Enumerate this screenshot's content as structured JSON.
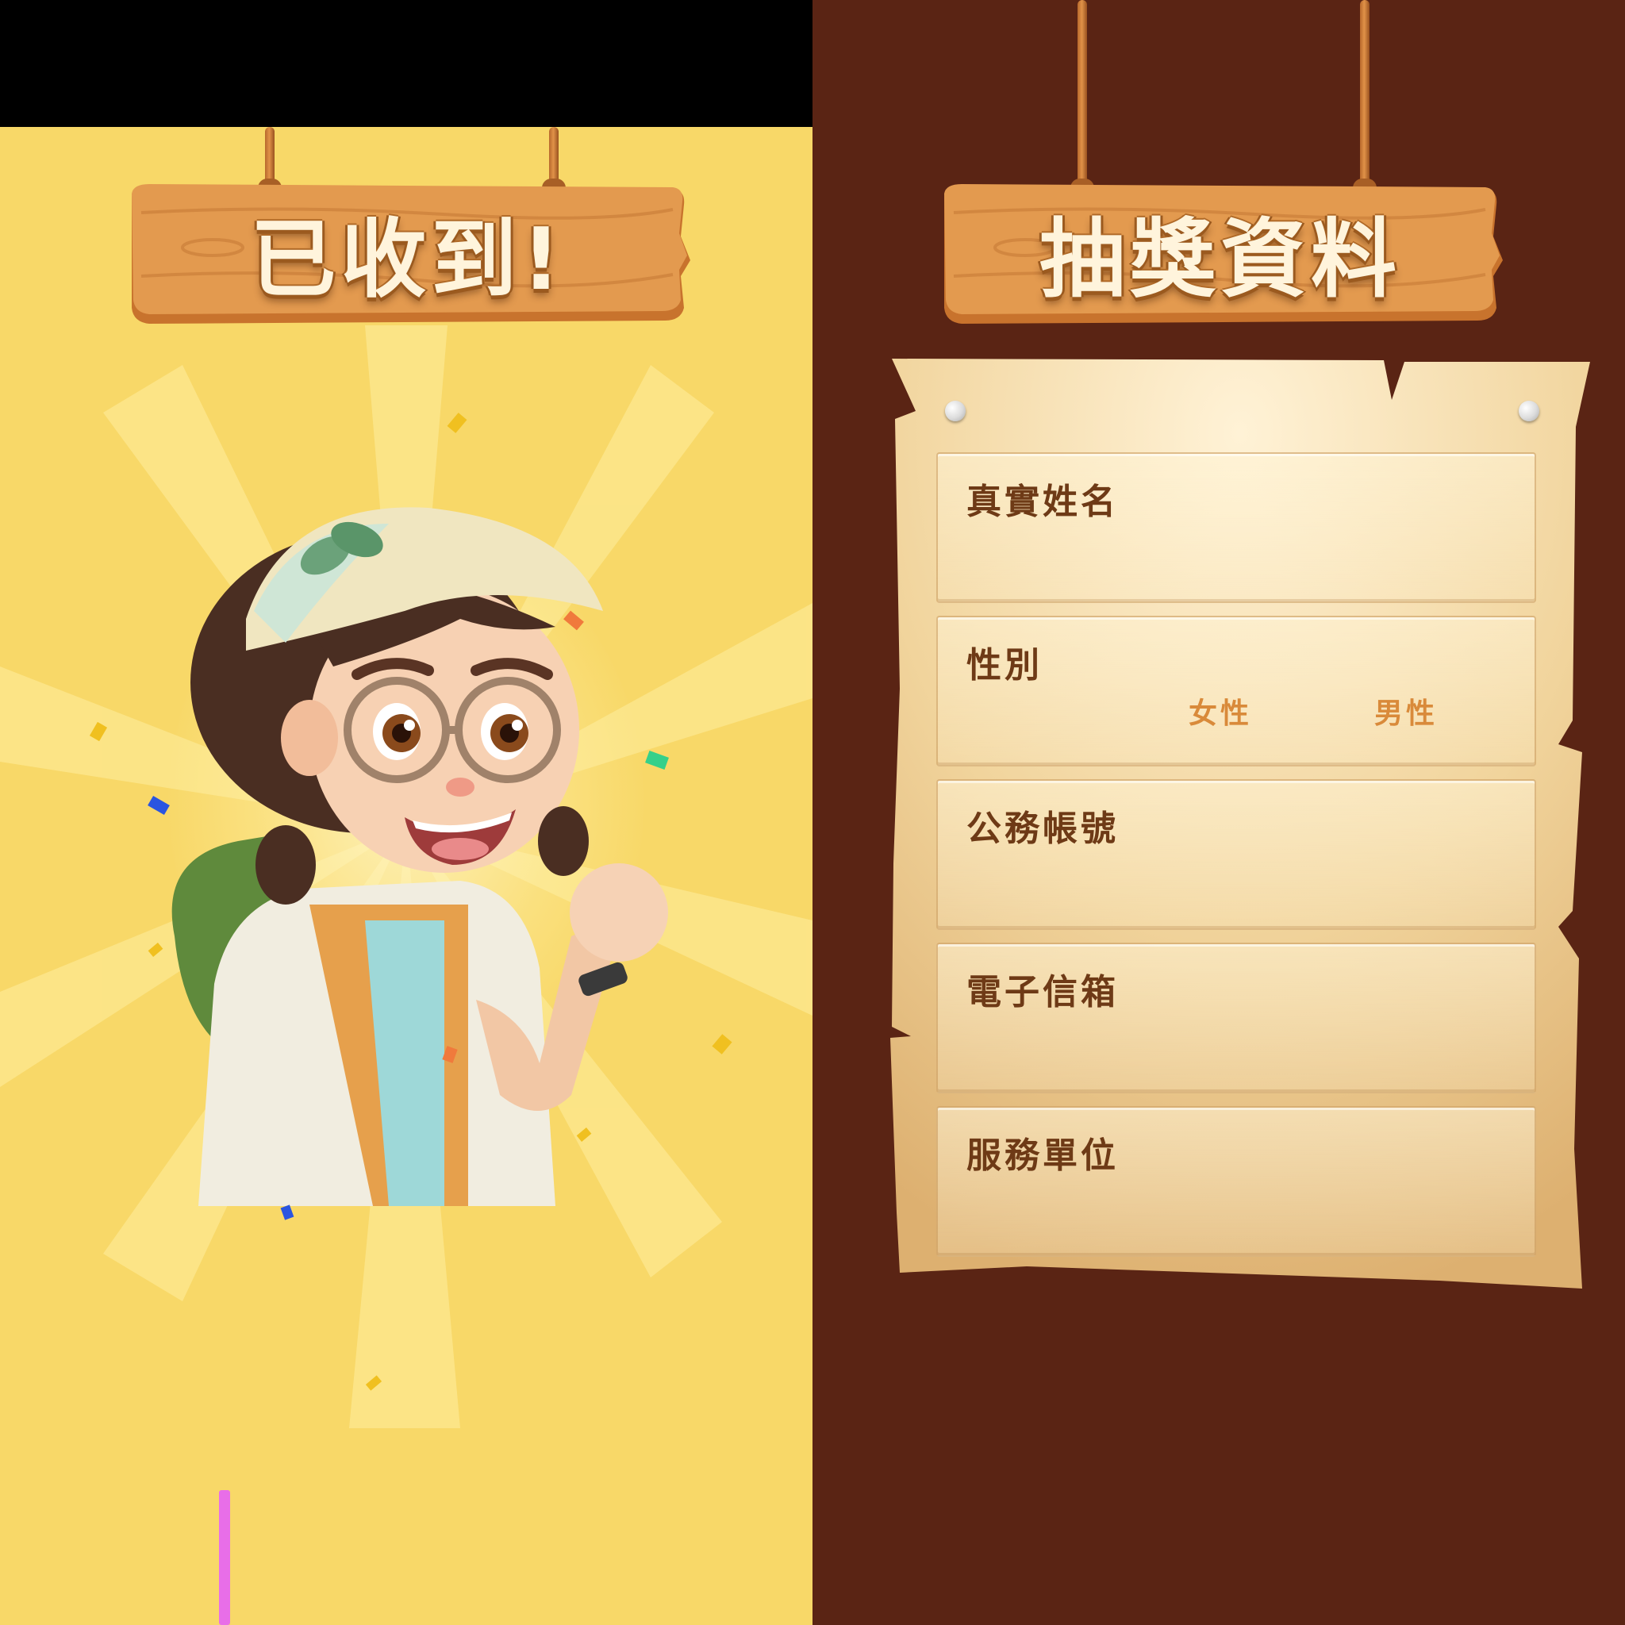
{
  "left_panel": {
    "title": "已收到!",
    "character": "explorer-girl-cheering",
    "background_color": "#f8d868"
  },
  "right_panel": {
    "title": "抽獎資料",
    "background_color": "#5a2414",
    "form": {
      "fields": [
        {
          "label": "真實姓名"
        },
        {
          "label": "性別",
          "options": [
            "女性",
            "男性"
          ]
        },
        {
          "label": "公務帳號"
        },
        {
          "label": "電子信箱"
        },
        {
          "label": "服務單位"
        }
      ]
    }
  },
  "colors": {
    "wood": "#d9893b",
    "wood_dark": "#9b5a1f",
    "parchment": "#f4d9a2",
    "label": "#6e3a16",
    "option": "#d98a3a"
  }
}
